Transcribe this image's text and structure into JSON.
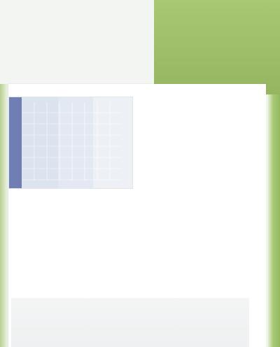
{
  "header": {
    "title": "",
    "subtitle": ""
  },
  "content": {
    "caption_lines": [
      "",
      "",
      ""
    ]
  },
  "footer": {
    "lines": [
      "",
      ""
    ]
  },
  "colors": {
    "accent_green": "#9fbf6a",
    "thumb_blue": "#6f7fb5",
    "caption_orange": "#b47a2c"
  },
  "icons": []
}
